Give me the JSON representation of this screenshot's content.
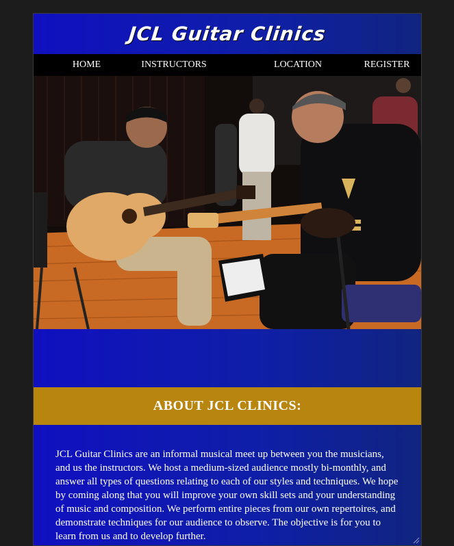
{
  "brand": {
    "title": "JCL Guitar Clinics"
  },
  "nav": {
    "items": [
      "HOME",
      "INSTRUCTORS",
      "LOCATION",
      "REGISTER"
    ]
  },
  "hero": {
    "image": "photo-guitar-instructor-and-student"
  },
  "about": {
    "heading": "ABOUT JCL CLINICS:",
    "body": "JCL Guitar Clinics are an informal musical meet up between you the musicians, and us the instructors. We host a medium-sized audience mostly bi-monthly, and answer all types of questions relating to each of our styles and techniques. We hope by coming along that you will improve your own skill sets and your understanding of music and composition. We perform entire pieces from our own repertoires, and demonstrate techniques for our audience to observe. The objective is for you to learn from us and to develop further."
  },
  "colors": {
    "page_bg": "#1c1c1c",
    "panel_blue": "#1010c0",
    "nav_bg": "#000000",
    "about_band": "#b8850f",
    "text": "#ffffff"
  },
  "icons": [
    "resize-handle-icon"
  ]
}
